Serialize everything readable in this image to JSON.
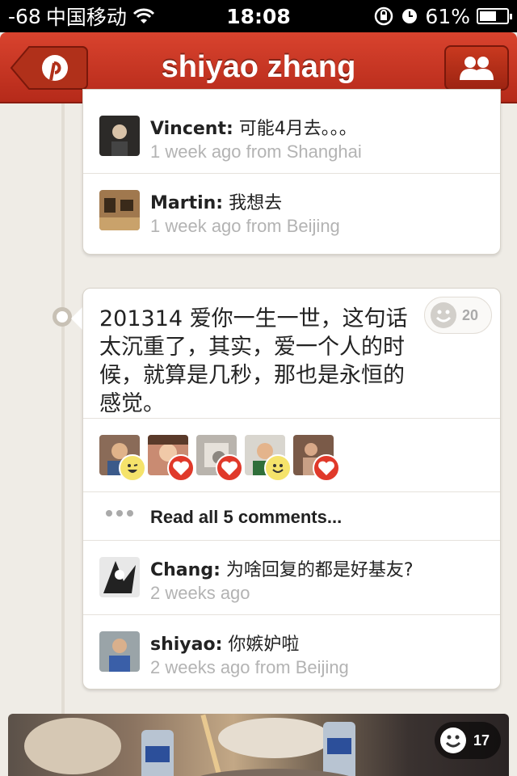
{
  "status_bar": {
    "signal": "-68",
    "carrier": "中国移动",
    "time": "18:08",
    "battery": "61%",
    "battery_level": 0.61
  },
  "nav": {
    "title": "shiyao zhang",
    "back_icon": "pinterest-p-icon",
    "right_icon": "friends-icon"
  },
  "top_card": {
    "comments": [
      {
        "name": "Vincent:",
        "text": " 可能4月去。。。",
        "meta": "1 week ago from Shanghai"
      },
      {
        "name": "Martin:",
        "text": " 我想去",
        "meta": "1 week ago from Beijing"
      }
    ]
  },
  "post": {
    "text": "201314 爱你一生一世，这句话太沉重了，其实，爱一个人的时候，就算是几秒，那也是永恒的感觉。",
    "smile_count": "20",
    "reactions": [
      {
        "type": "smile"
      },
      {
        "type": "heart"
      },
      {
        "type": "heart"
      },
      {
        "type": "smile"
      },
      {
        "type": "heart"
      }
    ],
    "read_all": "Read all 5 comments...",
    "comments": [
      {
        "name": "Chang:",
        "text": " 为啥回复的都是好基友?",
        "meta": "2 weeks ago"
      },
      {
        "name": "shiyao:",
        "text": " 你嫉妒啦",
        "meta": "2 weeks ago from Beijing"
      }
    ]
  },
  "photo_post": {
    "smile_count": "17"
  },
  "colors": {
    "nav_red": "#c8341f",
    "background": "#efece6",
    "heart": "#e0392a",
    "smile": "#f5e36b"
  }
}
